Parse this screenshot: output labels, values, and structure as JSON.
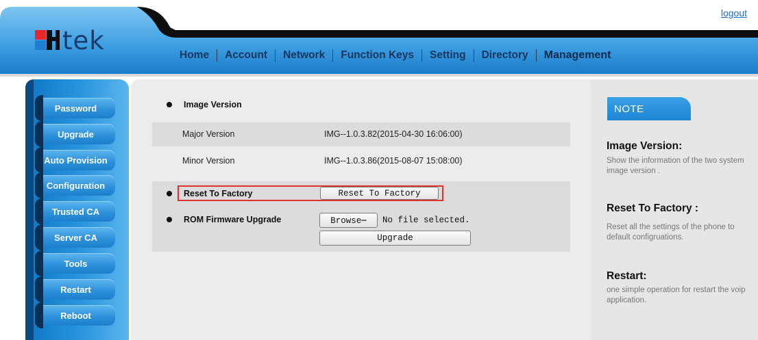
{
  "header": {
    "logo_text": "tek",
    "logout_label": "logout",
    "nav": [
      {
        "label": "Home"
      },
      {
        "label": "Account"
      },
      {
        "label": "Network"
      },
      {
        "label": "Function Keys"
      },
      {
        "label": "Setting"
      },
      {
        "label": "Directory"
      },
      {
        "label": "Management",
        "active": true
      }
    ]
  },
  "sidebar": {
    "items": [
      {
        "label": "Password"
      },
      {
        "label": "Upgrade"
      },
      {
        "label": "Auto Provision"
      },
      {
        "label": "Configuration"
      },
      {
        "label": "Trusted CA"
      },
      {
        "label": "Server CA"
      },
      {
        "label": "Tools"
      },
      {
        "label": "Restart"
      },
      {
        "label": "Reboot"
      }
    ]
  },
  "main": {
    "image_version": {
      "title": "Image Version",
      "rows": [
        {
          "label": "Major Version",
          "value": "IMG--1.0.3.82(2015-04-30 16:06:00)"
        },
        {
          "label": "Minor Version",
          "value": "IMG--1.0.3.86(2015-08-07 15:08:00)"
        }
      ]
    },
    "reset": {
      "title": "Reset To Factory",
      "button_label": "Reset To Factory"
    },
    "rom_upgrade": {
      "title": "ROM Firmware Upgrade",
      "browse_label": "Browse⋯",
      "file_status": "No file selected.",
      "upgrade_label": "Upgrade"
    }
  },
  "note": {
    "tab_label": "NOTE",
    "sections": [
      {
        "heading": "Image Version:",
        "text": "Show the information of the two system image version ."
      },
      {
        "heading": "Reset To Factory :",
        "text": "Reset all the settings of the phone to default configruations."
      },
      {
        "heading": "Restart:",
        "text": "one simple operation for restart the voip application."
      }
    ]
  },
  "colors": {
    "brand_blue": "#1e7fd0",
    "header_dark": "#0e0e0e",
    "highlight_red": "#e0312f"
  }
}
